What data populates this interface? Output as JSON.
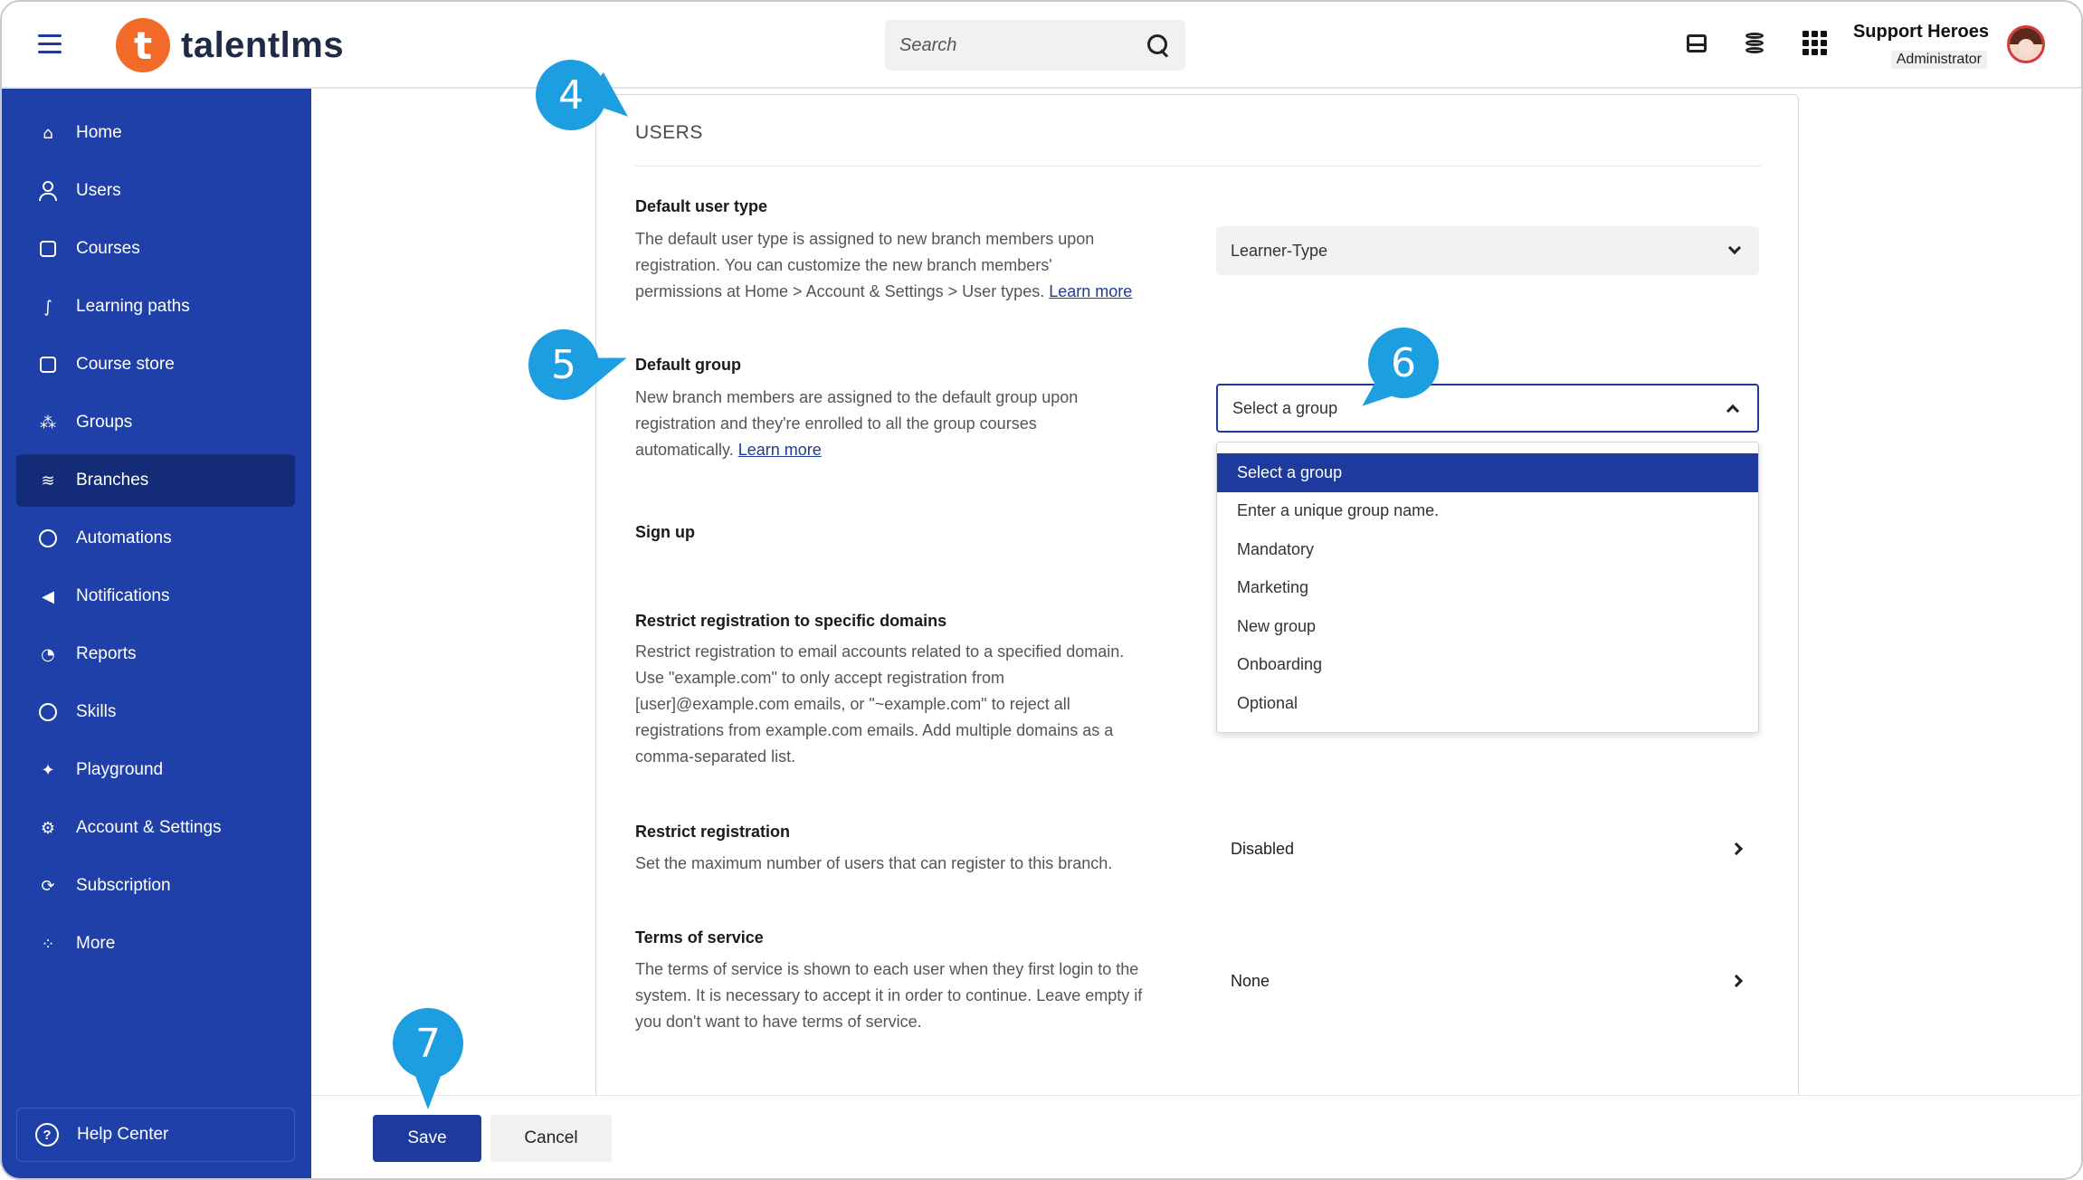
{
  "header": {
    "logo_mark": "t",
    "logo_text": "talentlms",
    "search_placeholder": "Search",
    "user_name": "Support Heroes",
    "user_role": "Administrator"
  },
  "sidebar": {
    "items": [
      {
        "label": "Home",
        "icon": "home-icon"
      },
      {
        "label": "Users",
        "icon": "user-icon"
      },
      {
        "label": "Courses",
        "icon": "course-icon"
      },
      {
        "label": "Learning paths",
        "icon": "path-icon"
      },
      {
        "label": "Course store",
        "icon": "store-icon"
      },
      {
        "label": "Groups",
        "icon": "groups-icon"
      },
      {
        "label": "Branches",
        "icon": "layers-icon",
        "active": true
      },
      {
        "label": "Automations",
        "icon": "automation-icon"
      },
      {
        "label": "Notifications",
        "icon": "megaphone-icon"
      },
      {
        "label": "Reports",
        "icon": "pie-chart-icon"
      },
      {
        "label": "Skills",
        "icon": "brain-icon"
      },
      {
        "label": "Playground",
        "icon": "sparkle-icon"
      },
      {
        "label": "Account & Settings",
        "icon": "gear-icon"
      },
      {
        "label": "Subscription",
        "icon": "refresh-icon"
      },
      {
        "label": "More",
        "icon": "grid-icon"
      }
    ],
    "help_label": "Help Center"
  },
  "section": {
    "title": "USERS"
  },
  "default_user_type": {
    "title": "Default user type",
    "desc_lines": [
      "The default user type is assigned to new branch members upon",
      "registration. You can customize the new branch members'",
      "permissions at Home > Account & Settings > User types. "
    ],
    "link": "Learn more",
    "value": "Learner-Type"
  },
  "default_group": {
    "title": "Default group",
    "desc_lines": [
      "New branch members are assigned to the default group upon",
      "registration and they're enrolled to all the group courses",
      "automatically. "
    ],
    "link": "Learn more",
    "value": "Select a group",
    "options": [
      "Select a group",
      "Enter a unique group name.",
      "Mandatory",
      "Marketing",
      "New group",
      "Onboarding",
      "Optional"
    ]
  },
  "sign_up": {
    "title": "Sign up"
  },
  "restrict_domains": {
    "title": "Restrict registration to specific domains",
    "desc_lines": [
      "Restrict registration to email accounts related to a specified domain.",
      "Use \"example.com\" to only accept registration from",
      "[user]@example.com emails, or \"~example.com\" to reject all",
      "registrations from example.com emails. Add multiple domains as a",
      "comma-separated list."
    ]
  },
  "restrict_registration": {
    "title": "Restrict registration",
    "desc": "Set the maximum number of users that can register to this branch.",
    "value": "Disabled"
  },
  "terms": {
    "title": "Terms of service",
    "desc_lines": [
      "The terms of service is shown to each user when they first login to the",
      "system. It is necessary to accept it in order to continue. Leave empty if",
      "you don't want to have terms of service."
    ],
    "value": "None"
  },
  "footer": {
    "save_label": "Save",
    "cancel_label": "Cancel"
  },
  "markers": [
    "4",
    "5",
    "6",
    "7"
  ],
  "colors": {
    "sidebar": "#1e40a8",
    "sidebar_active": "#142c78",
    "primary": "#1e3a9c",
    "brand_orange": "#f26a28",
    "marker": "#1d9ee0"
  }
}
